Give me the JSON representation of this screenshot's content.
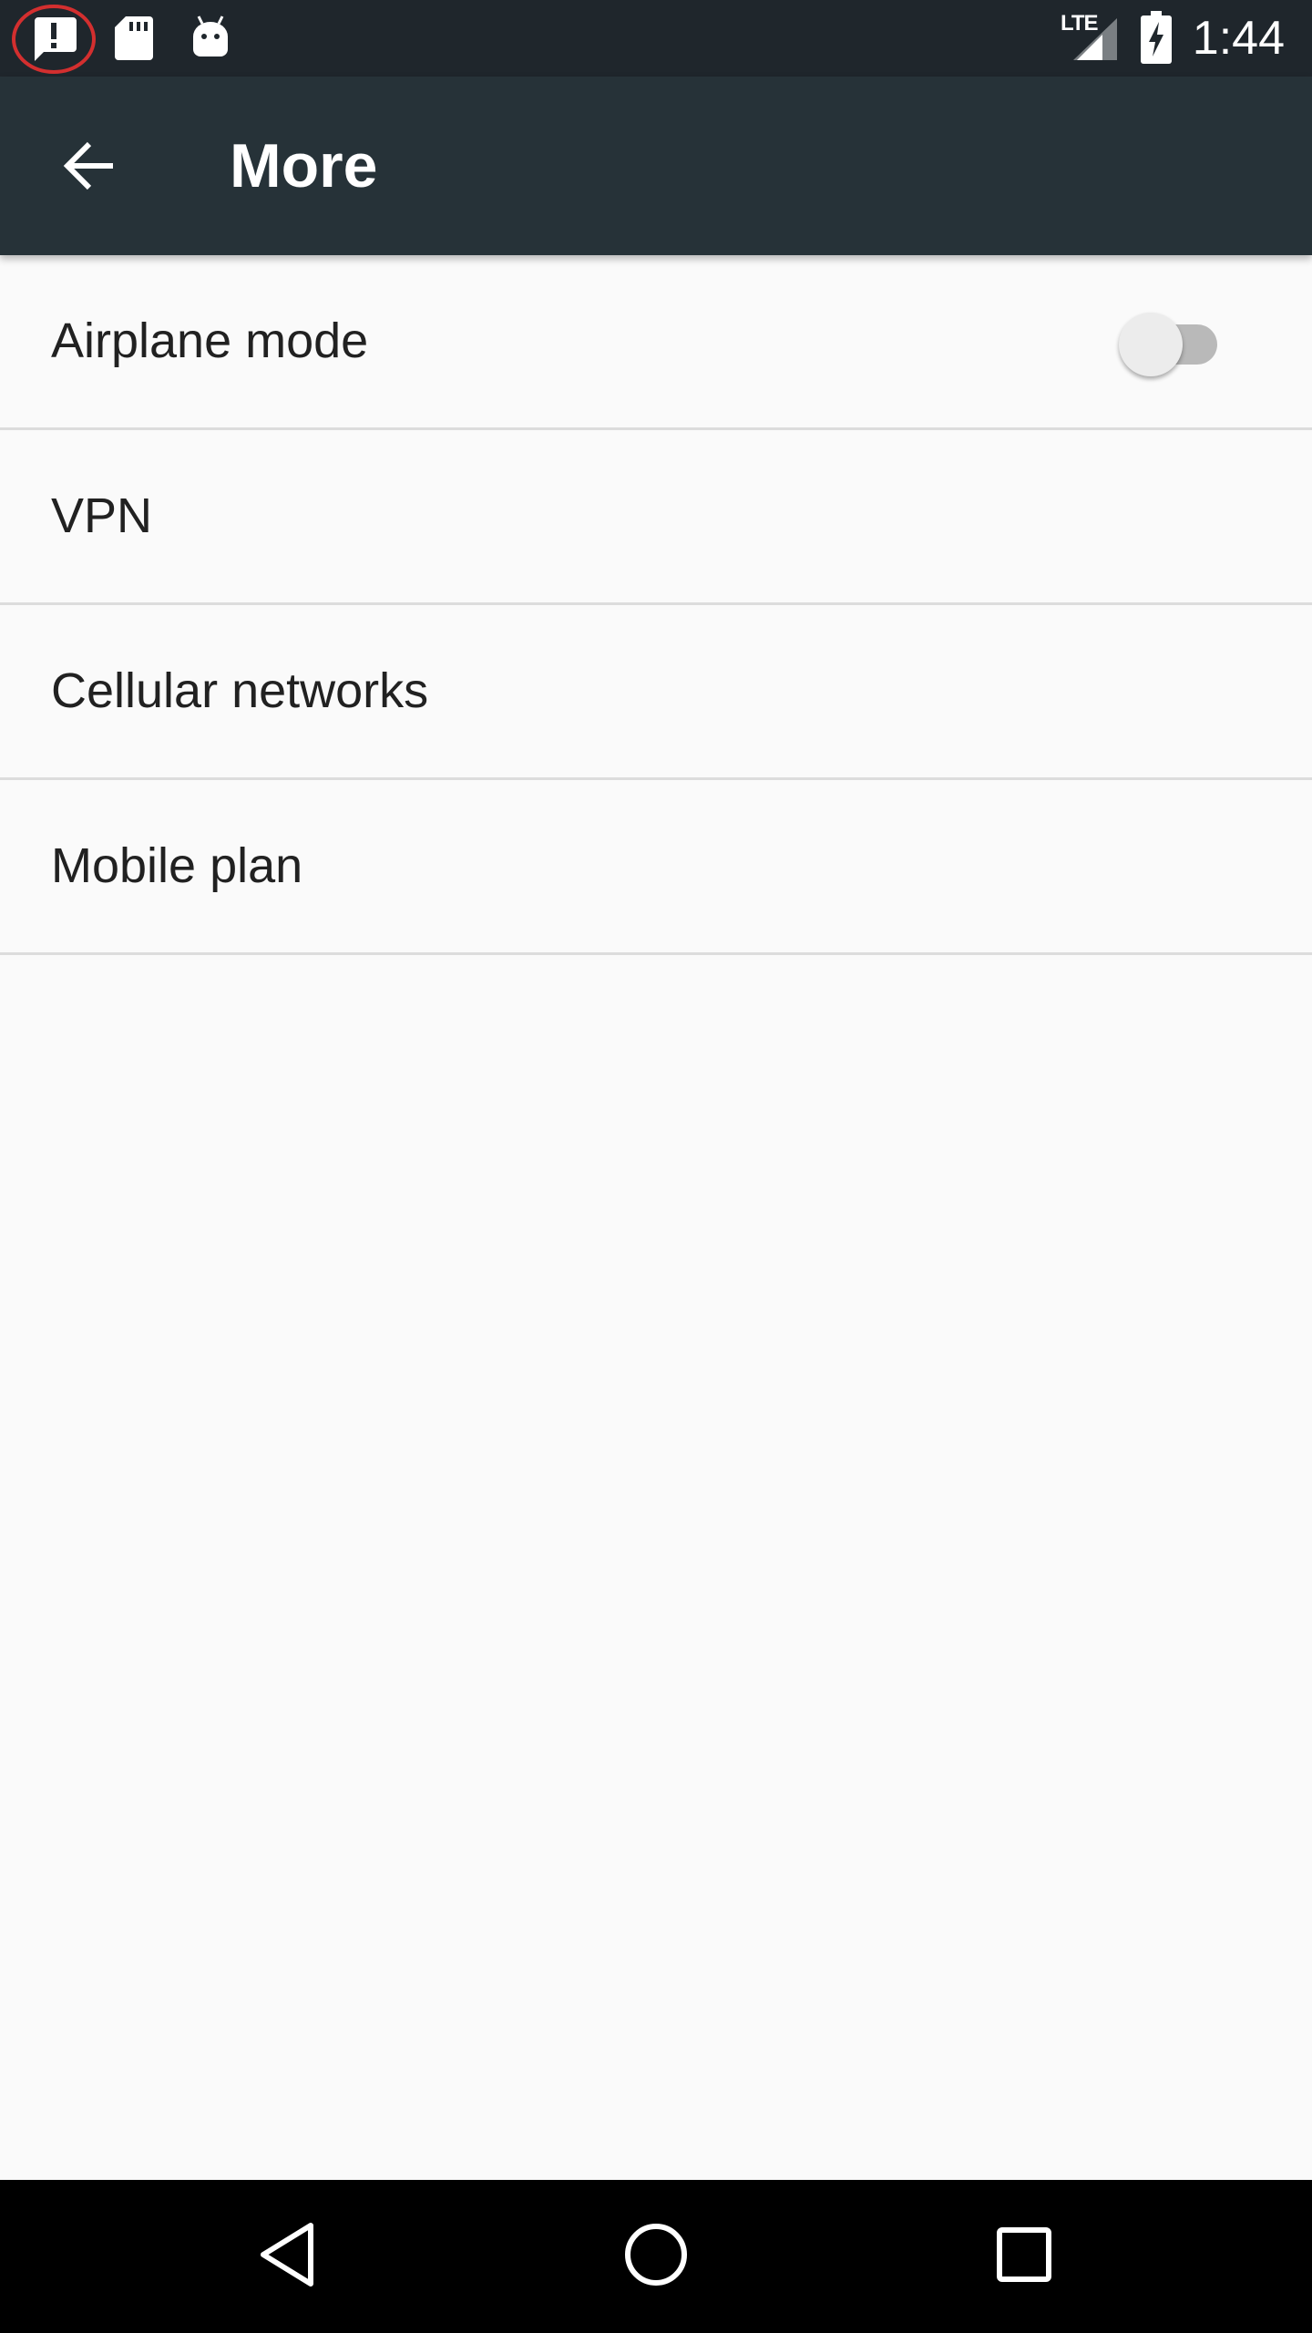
{
  "status_bar": {
    "time": "1:44",
    "network_label": "LTE",
    "left_icons": [
      "alert-notification-icon",
      "sd-card-icon",
      "android-debug-icon"
    ],
    "right_icons": [
      "cellular-signal-icon",
      "battery-charging-icon"
    ]
  },
  "app_bar": {
    "title": "More",
    "back_icon": "arrow-back-icon"
  },
  "settings": {
    "items": [
      {
        "label": "Airplane mode",
        "toggle": {
          "on": false
        }
      },
      {
        "label": "VPN"
      },
      {
        "label": "Cellular networks"
      },
      {
        "label": "Mobile plan"
      }
    ]
  },
  "nav_bar": {
    "icons": [
      "back-triangle-icon",
      "home-circle-icon",
      "recents-square-icon"
    ]
  },
  "colors": {
    "status_bar": "#1f262c",
    "app_bar": "#263238",
    "background": "#fafafa",
    "divider": "#dcdcdc",
    "highlight_ring": "#d32f2f"
  }
}
